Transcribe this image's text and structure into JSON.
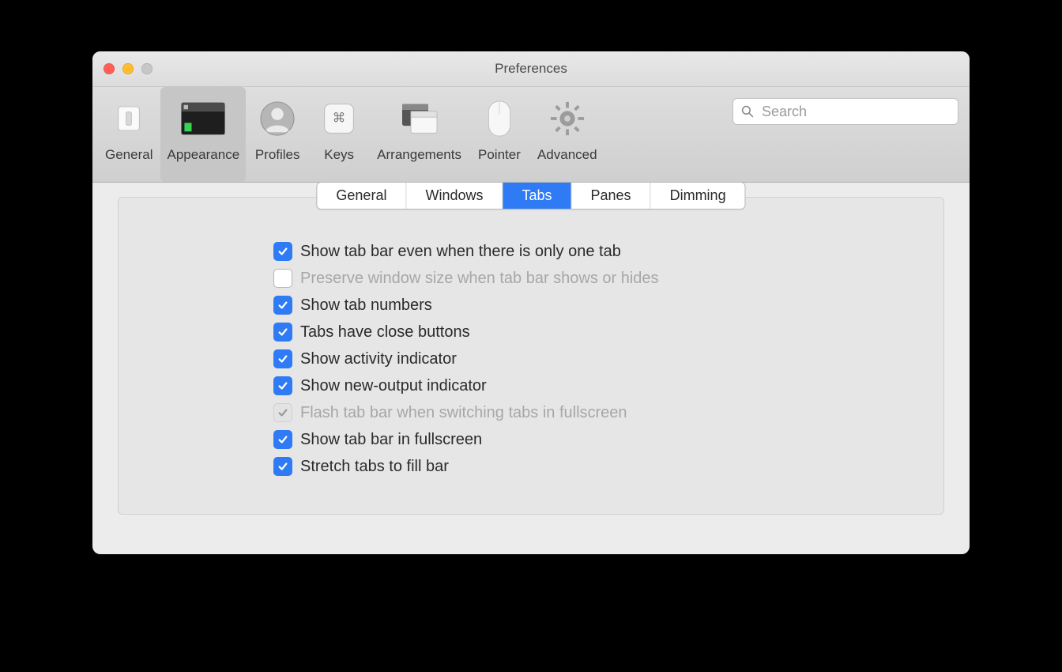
{
  "window": {
    "title": "Preferences"
  },
  "search": {
    "placeholder": "Search"
  },
  "toolbar": {
    "items": [
      {
        "id": "general",
        "label": "General",
        "selected": false
      },
      {
        "id": "appearance",
        "label": "Appearance",
        "selected": true
      },
      {
        "id": "profiles",
        "label": "Profiles",
        "selected": false
      },
      {
        "id": "keys",
        "label": "Keys",
        "selected": false
      },
      {
        "id": "arrangements",
        "label": "Arrangements",
        "selected": false
      },
      {
        "id": "pointer",
        "label": "Pointer",
        "selected": false
      },
      {
        "id": "advanced",
        "label": "Advanced",
        "selected": false
      }
    ]
  },
  "segmented": {
    "tabs": [
      {
        "id": "general",
        "label": "General",
        "active": false
      },
      {
        "id": "windows",
        "label": "Windows",
        "active": false
      },
      {
        "id": "tabs",
        "label": "Tabs",
        "active": true
      },
      {
        "id": "panes",
        "label": "Panes",
        "active": false
      },
      {
        "id": "dimming",
        "label": "Dimming",
        "active": false
      }
    ]
  },
  "checks": [
    {
      "id": "show-tab-bar-one-tab",
      "label": "Show tab bar even when there is only one tab",
      "checked": true,
      "enabled": true
    },
    {
      "id": "preserve-window-size",
      "label": "Preserve window size when tab bar shows or hides",
      "checked": false,
      "enabled": false
    },
    {
      "id": "show-tab-numbers",
      "label": "Show tab numbers",
      "checked": true,
      "enabled": true
    },
    {
      "id": "tabs-close-buttons",
      "label": "Tabs have close buttons",
      "checked": true,
      "enabled": true
    },
    {
      "id": "show-activity",
      "label": "Show activity indicator",
      "checked": true,
      "enabled": true
    },
    {
      "id": "show-new-output",
      "label": "Show new-output indicator",
      "checked": true,
      "enabled": true
    },
    {
      "id": "flash-tab-bar",
      "label": "Flash tab bar when switching tabs in fullscreen",
      "checked": true,
      "enabled": false
    },
    {
      "id": "tab-bar-fullscreen",
      "label": "Show tab bar in fullscreen",
      "checked": true,
      "enabled": true
    },
    {
      "id": "stretch-tabs",
      "label": "Stretch tabs to fill bar",
      "checked": true,
      "enabled": true
    }
  ]
}
